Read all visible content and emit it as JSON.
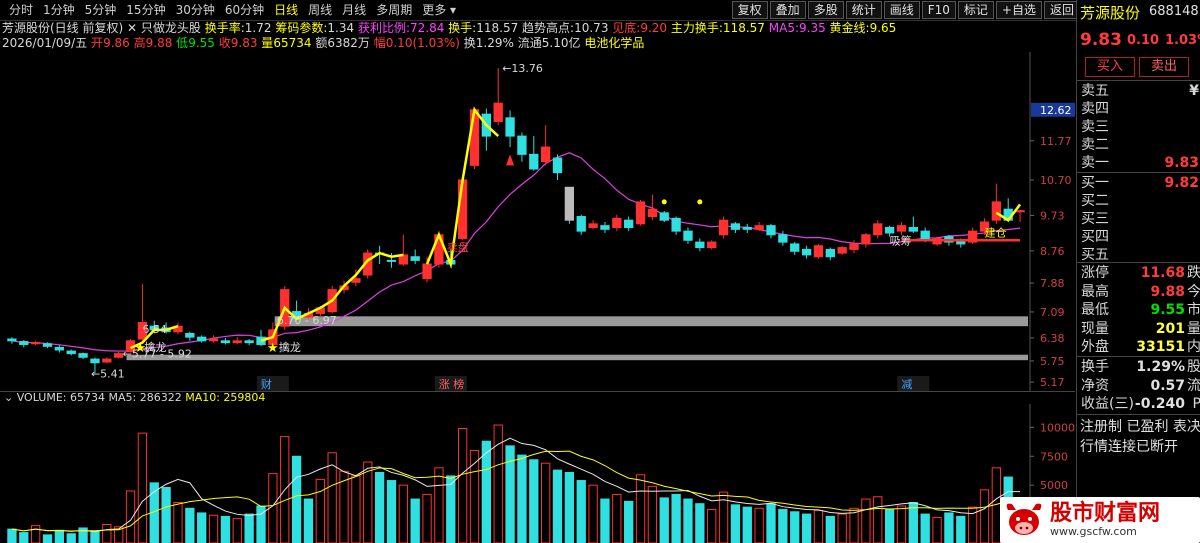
{
  "toolbar": {
    "periods": [
      "分时",
      "1分钟",
      "5分钟",
      "15分钟",
      "30分钟",
      "60分钟",
      "日线",
      "周线",
      "月线",
      "多周期",
      "更多"
    ],
    "active_period": "日线",
    "buttons": [
      "复权",
      "叠加",
      "多股",
      "统计",
      "画线",
      "F10",
      "标记",
      "+自选",
      "返回"
    ]
  },
  "info": {
    "stock_name": "芳源股份(日线 前复权)",
    "indicator_name": "只做龙头股",
    "turnover_label": "换手率:",
    "turnover": "1.72",
    "chip_label": "筹码参数:",
    "chip": "1.34",
    "profit_label": "获利比例:",
    "profit": "72.84",
    "hs_label": "换手:",
    "hs": "118.57",
    "trend_high_label": "趋势高点:",
    "trend_high": "10.73",
    "bottom_label": "见底:",
    "bottom": "9.20",
    "main_label": "主力换手:",
    "main": "118.57",
    "ma5_label": "MA5:",
    "ma5": "9.35",
    "gold_label": "黄金线:",
    "gold": "9.65",
    "date": "2026/01/09/五",
    "open_label": "开",
    "open": "9.86",
    "high_label": "高",
    "high": "9.88",
    "low_label": "低",
    "low": "9.55",
    "close_label": "收",
    "close": "9.83",
    "vol_label": "量",
    "vol": "65734",
    "amount_label": "额",
    "amount": "6382万",
    "amp_label": "幅",
    "amp": "0.10(1.03%)",
    "turn_label": "换",
    "turn": "1.29%",
    "float_label": "流通",
    "float": "5.10亿",
    "sector": "电池化学品"
  },
  "chart_data": {
    "type": "candlestick",
    "ylim": [
      4.9,
      14.2
    ],
    "yticks": [
      "12.62",
      "11.77",
      "10.70",
      "9.73",
      "8.76",
      "7.88",
      "7.09",
      "6.38",
      "5.75",
      "5.17"
    ],
    "current_price_tag": "12.62",
    "annotations": {
      "high_label": "13.76",
      "low_label": "5.41",
      "band1_label": "5.77 - 5.92",
      "band2_label": "6.70 - 6.97",
      "star1": "擒龙",
      "star2": "擒龙",
      "t1": "吸筹",
      "t2": "建仓",
      "t3": "卖盘",
      "t4": "6.54"
    },
    "bottom_markers": [
      "财",
      "涨 榜",
      "减"
    ],
    "candles": [
      [
        6.35,
        6.3,
        6.4,
        6.22,
        0
      ],
      [
        6.28,
        6.2,
        6.32,
        6.12,
        0
      ],
      [
        6.22,
        6.25,
        6.3,
        6.18,
        1
      ],
      [
        6.22,
        6.15,
        6.26,
        6.1,
        0
      ],
      [
        6.12,
        6.05,
        6.18,
        5.98,
        0
      ],
      [
        6.02,
        5.95,
        6.06,
        5.9,
        0
      ],
      [
        5.95,
        5.85,
        5.98,
        5.8,
        0
      ],
      [
        5.8,
        5.7,
        5.84,
        5.41,
        0
      ],
      [
        5.72,
        5.8,
        5.85,
        5.68,
        1
      ],
      [
        5.85,
        5.95,
        6.0,
        5.82,
        1
      ],
      [
        6.0,
        6.3,
        6.35,
        5.98,
        1
      ],
      [
        6.35,
        6.8,
        7.85,
        6.3,
        1
      ],
      [
        6.7,
        6.6,
        6.85,
        6.5,
        0
      ],
      [
        6.65,
        6.55,
        6.8,
        6.5,
        0
      ],
      [
        6.55,
        6.7,
        6.8,
        6.48,
        1
      ],
      [
        6.5,
        6.4,
        6.55,
        6.3,
        0
      ],
      [
        6.4,
        6.3,
        6.45,
        6.25,
        0
      ],
      [
        6.3,
        6.35,
        6.45,
        6.25,
        1
      ],
      [
        6.3,
        6.25,
        6.38,
        6.2,
        0
      ],
      [
        6.25,
        6.3,
        6.4,
        6.2,
        1
      ],
      [
        6.3,
        6.25,
        6.35,
        6.18,
        0
      ],
      [
        6.4,
        6.2,
        6.6,
        6.15,
        0
      ],
      [
        6.2,
        6.6,
        6.8,
        6.15,
        1
      ],
      [
        6.7,
        7.7,
        7.8,
        6.6,
        1
      ],
      [
        7.1,
        6.9,
        7.4,
        6.85,
        0
      ],
      [
        6.95,
        7.05,
        7.2,
        6.9,
        1
      ],
      [
        7.05,
        7.2,
        7.25,
        6.95,
        1
      ],
      [
        7.1,
        7.7,
        7.8,
        7.05,
        1
      ],
      [
        7.7,
        7.8,
        7.95,
        7.6,
        1
      ],
      [
        7.9,
        8.0,
        8.25,
        7.8,
        1
      ],
      [
        8.1,
        8.7,
        8.8,
        8.0,
        1
      ],
      [
        8.7,
        8.7,
        8.9,
        8.4,
        0
      ],
      [
        8.5,
        8.5,
        8.7,
        8.3,
        0
      ],
      [
        8.4,
        8.65,
        9.2,
        8.35,
        1
      ],
      [
        8.6,
        8.5,
        8.8,
        8.4,
        0
      ],
      [
        8.0,
        8.4,
        8.6,
        7.9,
        1
      ],
      [
        8.4,
        9.2,
        9.3,
        8.3,
        1
      ],
      [
        8.5,
        8.4,
        8.8,
        8.3,
        0
      ],
      [
        9.1,
        10.7,
        10.75,
        9.05,
        1
      ],
      [
        11.1,
        12.62,
        12.7,
        11.0,
        1
      ],
      [
        12.5,
        11.9,
        12.65,
        11.5,
        0
      ],
      [
        12.3,
        12.8,
        13.76,
        12.2,
        1
      ],
      [
        12.4,
        11.9,
        12.6,
        11.6,
        0
      ],
      [
        11.9,
        11.4,
        12.0,
        11.2,
        0
      ],
      [
        11.4,
        11.0,
        11.9,
        10.95,
        0
      ],
      [
        11.2,
        11.6,
        12.2,
        11.1,
        1
      ],
      [
        11.3,
        10.9,
        11.4,
        10.7,
        0
      ],
      [
        10.5,
        9.6,
        10.5,
        9.5,
        0
      ],
      [
        9.7,
        9.3,
        9.75,
        9.2,
        0
      ],
      [
        9.4,
        9.5,
        9.6,
        9.35,
        1
      ],
      [
        9.45,
        9.35,
        9.55,
        9.25,
        0
      ],
      [
        9.4,
        9.65,
        9.75,
        9.3,
        1
      ],
      [
        9.6,
        9.4,
        9.7,
        9.3,
        0
      ],
      [
        9.5,
        10.1,
        10.15,
        9.45,
        1
      ],
      [
        9.7,
        9.9,
        10.3,
        9.6,
        1
      ],
      [
        9.8,
        9.6,
        9.85,
        9.55,
        0
      ],
      [
        9.65,
        9.3,
        9.7,
        9.2,
        0
      ],
      [
        9.3,
        9.05,
        9.4,
        8.95,
        0
      ],
      [
        9.0,
        8.85,
        9.1,
        8.75,
        0
      ],
      [
        8.85,
        9.0,
        9.05,
        8.8,
        1
      ],
      [
        9.2,
        9.6,
        9.7,
        9.1,
        1
      ],
      [
        9.5,
        9.35,
        9.55,
        9.25,
        0
      ],
      [
        9.4,
        9.35,
        9.5,
        9.25,
        0
      ],
      [
        9.35,
        9.45,
        9.55,
        9.3,
        1
      ],
      [
        9.45,
        9.2,
        9.5,
        9.1,
        0
      ],
      [
        9.2,
        9.0,
        9.3,
        8.9,
        0
      ],
      [
        8.95,
        8.75,
        9.0,
        8.65,
        0
      ],
      [
        8.8,
        8.65,
        8.9,
        8.55,
        0
      ],
      [
        8.6,
        8.9,
        8.95,
        8.55,
        1
      ],
      [
        8.8,
        8.6,
        8.85,
        8.5,
        0
      ],
      [
        8.7,
        8.85,
        8.9,
        8.65,
        1
      ],
      [
        8.8,
        8.95,
        9.05,
        8.7,
        1
      ],
      [
        8.95,
        9.2,
        9.25,
        8.85,
        1
      ],
      [
        9.2,
        9.5,
        9.6,
        9.1,
        1
      ],
      [
        9.4,
        9.25,
        9.45,
        9.15,
        0
      ],
      [
        9.3,
        9.45,
        9.55,
        9.2,
        1
      ],
      [
        9.4,
        9.3,
        9.7,
        9.25,
        0
      ],
      [
        9.3,
        9.1,
        9.4,
        9.0,
        0
      ],
      [
        9.1,
        8.95,
        9.15,
        8.9,
        1
      ],
      [
        9.0,
        9.15,
        9.2,
        8.9,
        0
      ],
      [
        9.05,
        8.95,
        9.1,
        8.85,
        0
      ],
      [
        9.0,
        9.3,
        9.4,
        8.95,
        1
      ],
      [
        9.3,
        9.55,
        9.65,
        9.2,
        1
      ],
      [
        9.6,
        10.1,
        10.6,
        9.5,
        1
      ],
      [
        9.9,
        9.6,
        10.2,
        9.55,
        0
      ],
      [
        9.86,
        9.83,
        9.88,
        9.55,
        1
      ]
    ],
    "volumes": [
      [
        1200,
        0
      ],
      [
        900,
        0
      ],
      [
        1500,
        1
      ],
      [
        700,
        0
      ],
      [
        1100,
        0
      ],
      [
        800,
        0
      ],
      [
        1300,
        0
      ],
      [
        1000,
        0
      ],
      [
        1600,
        1
      ],
      [
        1400,
        1
      ],
      [
        4500,
        1
      ],
      [
        9500,
        1
      ],
      [
        5200,
        0
      ],
      [
        4800,
        0
      ],
      [
        3500,
        1
      ],
      [
        3000,
        0
      ],
      [
        2600,
        0
      ],
      [
        2400,
        1
      ],
      [
        2300,
        0
      ],
      [
        2100,
        1
      ],
      [
        2500,
        0
      ],
      [
        3200,
        0
      ],
      [
        6000,
        1
      ],
      [
        9200,
        1
      ],
      [
        7500,
        0
      ],
      [
        3800,
        0
      ],
      [
        5500,
        1
      ],
      [
        7800,
        1
      ],
      [
        6200,
        1
      ],
      [
        5800,
        1
      ],
      [
        7000,
        1
      ],
      [
        6100,
        0
      ],
      [
        5400,
        0
      ],
      [
        5000,
        1
      ],
      [
        3800,
        0
      ],
      [
        4200,
        1
      ],
      [
        6500,
        1
      ],
      [
        5800,
        0
      ],
      [
        9900,
        1
      ],
      [
        8000,
        1
      ],
      [
        8800,
        0
      ],
      [
        10200,
        1
      ],
      [
        8400,
        0
      ],
      [
        7600,
        0
      ],
      [
        7200,
        0
      ],
      [
        6900,
        1
      ],
      [
        6300,
        0
      ],
      [
        6100,
        0
      ],
      [
        5400,
        0
      ],
      [
        5000,
        1
      ],
      [
        3800,
        0
      ],
      [
        4200,
        1
      ],
      [
        3600,
        0
      ],
      [
        5900,
        1
      ],
      [
        4900,
        1
      ],
      [
        3900,
        0
      ],
      [
        4200,
        0
      ],
      [
        3800,
        0
      ],
      [
        3400,
        0
      ],
      [
        2900,
        1
      ],
      [
        4400,
        1
      ],
      [
        3300,
        0
      ],
      [
        3100,
        0
      ],
      [
        3000,
        1
      ],
      [
        3400,
        0
      ],
      [
        2900,
        0
      ],
      [
        2700,
        0
      ],
      [
        2500,
        0
      ],
      [
        2800,
        1
      ],
      [
        2300,
        0
      ],
      [
        2500,
        1
      ],
      [
        3000,
        1
      ],
      [
        3800,
        1
      ],
      [
        4000,
        1
      ],
      [
        2900,
        0
      ],
      [
        3200,
        1
      ],
      [
        3500,
        0
      ],
      [
        2500,
        0
      ],
      [
        2200,
        1
      ],
      [
        2600,
        0
      ],
      [
        2300,
        0
      ],
      [
        3100,
        1
      ],
      [
        4600,
        1
      ],
      [
        6500,
        1
      ],
      [
        5700,
        0
      ],
      [
        2300,
        1
      ]
    ],
    "volume_yticks": [
      "10000",
      "7500",
      "5000",
      "2500"
    ],
    "volume_header": {
      "label": "VOLUME: 65734",
      "ma5": "MA5: 286322",
      "ma10": "MA10: 259804"
    }
  },
  "quote": {
    "name": "芳源股份",
    "code": "688148",
    "price": "9.83",
    "change": "0.10",
    "pct": "1.03%",
    "buy_btn": "买入",
    "sell_btn": "卖出",
    "asks": [
      {
        "label": "卖五",
        "val": "¥"
      },
      {
        "label": "卖四",
        "val": ""
      },
      {
        "label": "卖三",
        "val": ""
      },
      {
        "label": "卖二",
        "val": ""
      },
      {
        "label": "卖一",
        "val": "9.83"
      }
    ],
    "bids": [
      {
        "label": "买一",
        "val": "9.82"
      },
      {
        "label": "买二",
        "val": ""
      },
      {
        "label": "买三",
        "val": ""
      },
      {
        "label": "买四",
        "val": ""
      },
      {
        "label": "买五",
        "val": ""
      }
    ],
    "stats": [
      {
        "label": "涨停",
        "val": "11.68",
        "suffix": "跌"
      },
      {
        "label": "最高",
        "val": "9.88",
        "suffix": "今"
      },
      {
        "label": "最低",
        "val": "9.55",
        "suffix": "市"
      },
      {
        "label": "现量",
        "val": "201",
        "suffix": "量"
      },
      {
        "label": "外盘",
        "val": "33151",
        "suffix": "内"
      }
    ],
    "stats2": [
      {
        "label": "换手",
        "val": "1.29%",
        "suffix": "股"
      },
      {
        "label": "净资",
        "val": "0.57",
        "suffix": "流"
      },
      {
        "label": "收益(三)",
        "val": "-0.240",
        "suffix": "P"
      }
    ],
    "footer1": "注册制 已盈利 表决",
    "footer2": "行情连接已断开"
  },
  "watermark": {
    "title": "股市财富网",
    "url": "www.gscfw.com"
  }
}
